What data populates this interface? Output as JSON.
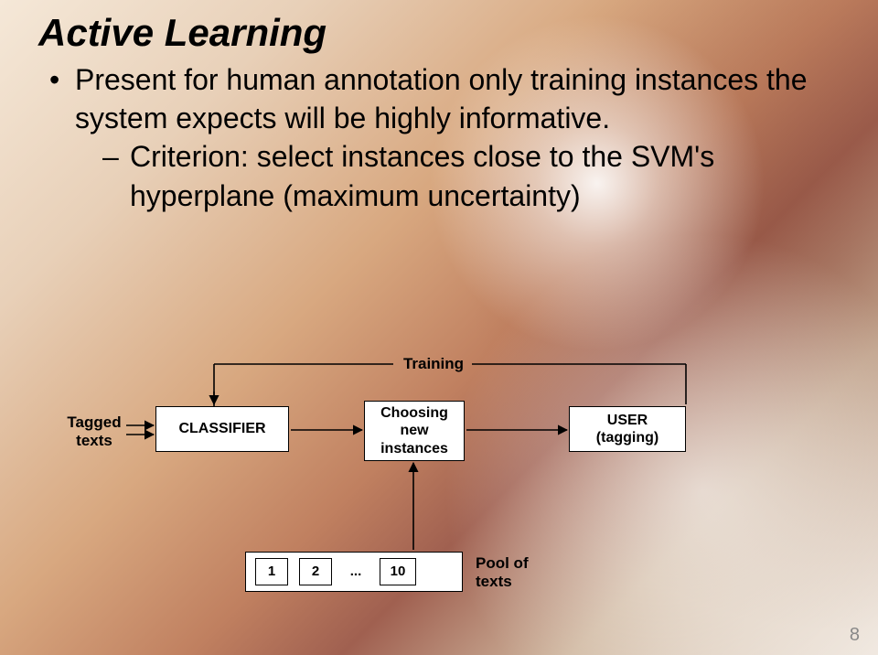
{
  "title": "Active Learning",
  "bullets": {
    "main": "Present for human annotation only training instances the system expects will be highly informative.",
    "sub": "Criterion: select instances close to the SVM's hyperplane (maximum uncertainty)"
  },
  "diagram": {
    "training_label": "Training",
    "tagged_texts_label": "Tagged\ntexts",
    "classifier_label": "CLASSIFIER",
    "choosing_label": "Choosing\nnew\ninstances",
    "user_label": "USER\n(tagging)",
    "pool": {
      "items": [
        "1",
        "2",
        "...",
        "10"
      ],
      "label": "Pool of\ntexts"
    }
  },
  "page_number": "8"
}
